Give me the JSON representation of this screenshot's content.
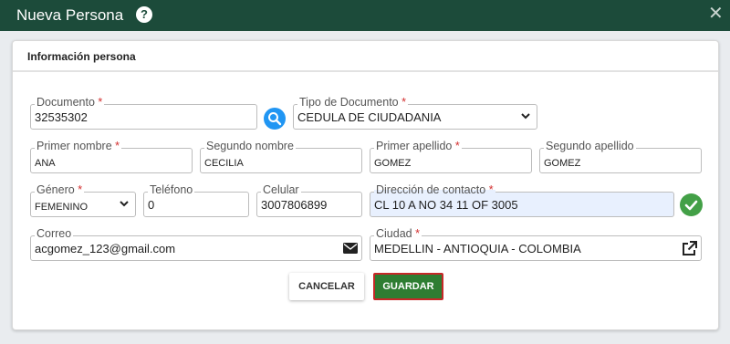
{
  "window": {
    "title": "Nueva Persona",
    "help_glyph": "?",
    "close_glyph": "✕"
  },
  "panel": {
    "title": "Información persona"
  },
  "fields": {
    "documento": {
      "label": "Documento",
      "value": "32535302"
    },
    "tipo_documento": {
      "label": "Tipo de Documento",
      "value": "CEDULA DE CIUDADANIA"
    },
    "primer_nombre": {
      "label": "Primer nombre",
      "value": "ANA"
    },
    "segundo_nombre": {
      "label": "Segundo nombre",
      "value": "CECILIA"
    },
    "primer_apellido": {
      "label": "Primer apellido",
      "value": "GOMEZ"
    },
    "segundo_apellido": {
      "label": "Segundo apellido",
      "value": "GOMEZ"
    },
    "genero": {
      "label": "Género",
      "value": "FEMENINO"
    },
    "telefono": {
      "label": "Teléfono",
      "value": "0"
    },
    "celular": {
      "label": "Celular",
      "value": "3007806899"
    },
    "direccion": {
      "label": "Dirección de contacto",
      "value": "CL 10 A NO 34 11 OF 3005"
    },
    "correo": {
      "label": "Correo",
      "value": "acgomez_123@gmail.com"
    },
    "ciudad": {
      "label": "Ciudad",
      "value": "MEDELLIN - ANTIOQUIA - COLOMBIA"
    }
  },
  "required_mark": "*",
  "buttons": {
    "cancel": "CANCELAR",
    "save": "GUARDAR"
  },
  "colors": {
    "header": "#1c4b3a",
    "search": "#2196f3",
    "valid": "#43a047",
    "save": "#2e7d32",
    "save_border": "#c62828",
    "required": "#d32f2f"
  },
  "icons": {
    "help": "help-icon",
    "close": "close-icon",
    "search": "search-icon",
    "check": "check-icon",
    "mail": "envelope-icon",
    "external": "external-link-icon",
    "dropdown": "chevron-down-icon"
  }
}
